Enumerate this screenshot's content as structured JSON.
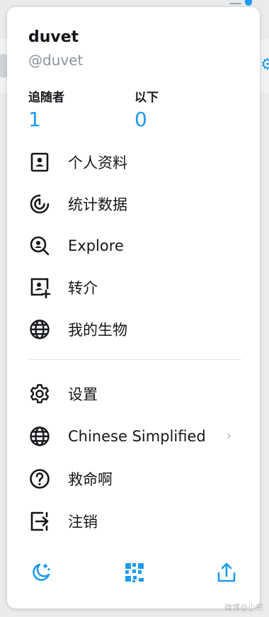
{
  "profile": {
    "name": "duvet",
    "handle": "@duvet"
  },
  "stats": {
    "followers_label": "追随者",
    "followers_value": "1",
    "following_label": "以下",
    "following_value": "0"
  },
  "menu_primary": [
    {
      "label": "个人资料",
      "icon": "profile-icon"
    },
    {
      "label": "统计数据",
      "icon": "stats-icon"
    },
    {
      "label": "Explore",
      "icon": "explore-icon"
    },
    {
      "label": "转介",
      "icon": "referral-icon"
    },
    {
      "label": "我的生物",
      "icon": "globe-icon"
    }
  ],
  "menu_secondary": [
    {
      "label": "设置",
      "icon": "gear-icon"
    },
    {
      "label": "Chinese Simplified",
      "icon": "globe-icon",
      "chevron": "›"
    },
    {
      "label": "救命啊",
      "icon": "help-icon"
    },
    {
      "label": "注销",
      "icon": "logout-icon"
    }
  ],
  "bottom_bar": [
    "dark-mode-icon",
    "qr-code-icon",
    "share-icon"
  ],
  "watermark": "微博@小宗",
  "colors": {
    "accent": "#1d9bf0",
    "text": "#14171a",
    "muted": "#8a939b"
  }
}
